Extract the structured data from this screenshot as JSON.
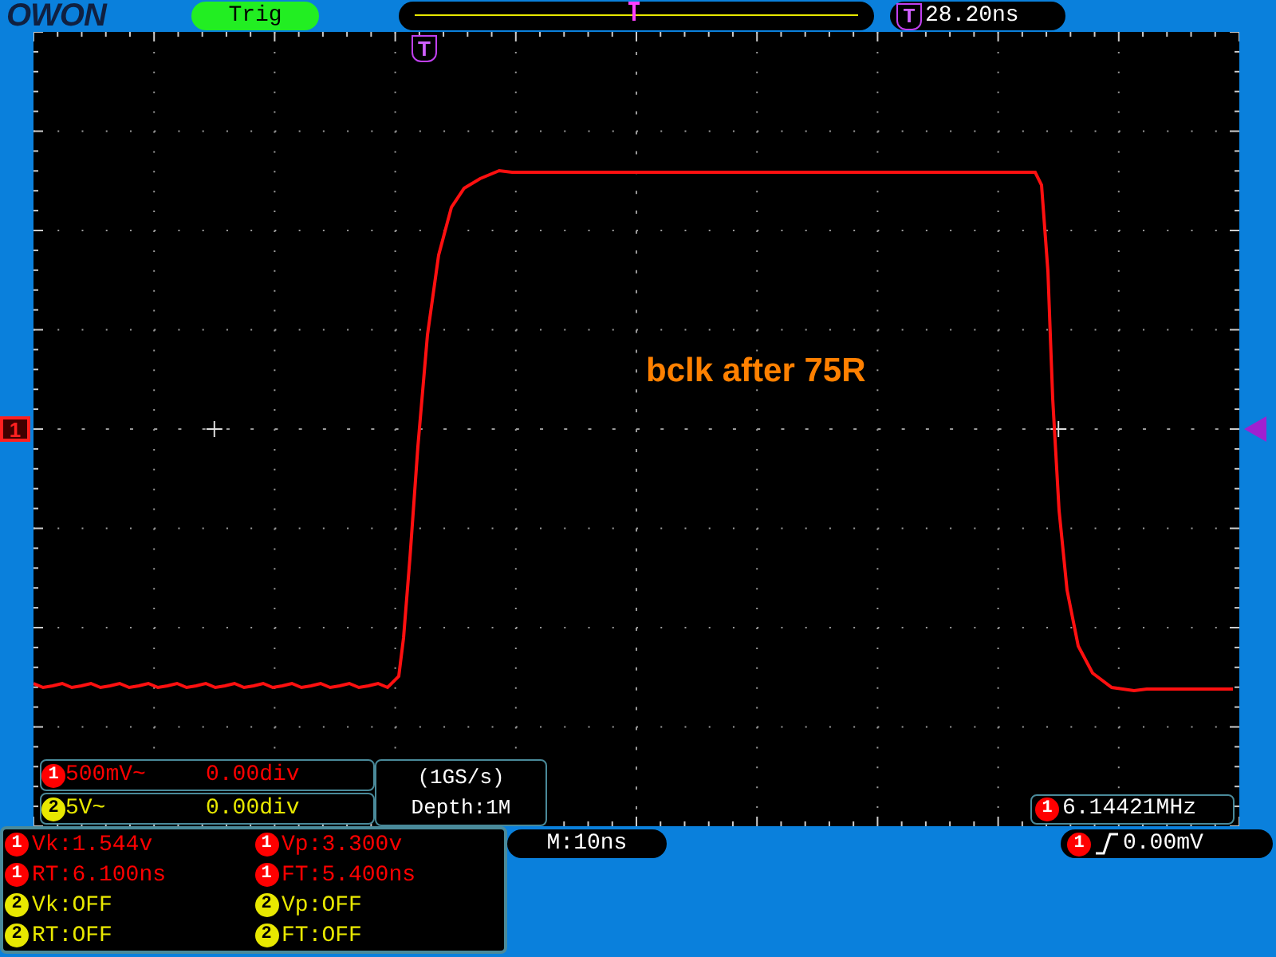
{
  "logo": "OWON",
  "trigger_status": "Trig",
  "trigger_time": {
    "marker": "T",
    "value": "28.20ns"
  },
  "screen_trigger_marker": "T",
  "annotation": "bclk after 75R",
  "channel_marker": "1",
  "channels": [
    {
      "number": "1",
      "scale": "500mV~",
      "offset": "0.00div",
      "color": "#ff0000"
    },
    {
      "number": "2",
      "scale": "5V~",
      "offset": "0.00div",
      "color": "#e8e800"
    }
  ],
  "acquisition": {
    "sample_rate": "(1GS/s)",
    "depth": "Depth:1M"
  },
  "frequency": {
    "channel": "1",
    "value": "6.14421MHz",
    "color": "#ff0000"
  },
  "measurements": [
    {
      "channel": "1",
      "text": "Vk:1.544v",
      "color": "#ff0000"
    },
    {
      "channel": "1",
      "text": "Vp:3.300v",
      "color": "#ff0000"
    },
    {
      "channel": "1",
      "text": "RT:6.100ns",
      "color": "#ff0000"
    },
    {
      "channel": "1",
      "text": "FT:5.400ns",
      "color": "#ff0000"
    },
    {
      "channel": "2",
      "text": "Vk:OFF",
      "color": "#e8e800"
    },
    {
      "channel": "2",
      "text": "Vp:OFF",
      "color": "#e8e800"
    },
    {
      "channel": "2",
      "text": "RT:OFF",
      "color": "#e8e800"
    },
    {
      "channel": "2",
      "text": "FT:OFF",
      "color": "#e8e800"
    }
  ],
  "timebase": "M:10ns",
  "trigger": {
    "channel": "1",
    "level": "0.00mV",
    "color": "#ff0000"
  }
}
